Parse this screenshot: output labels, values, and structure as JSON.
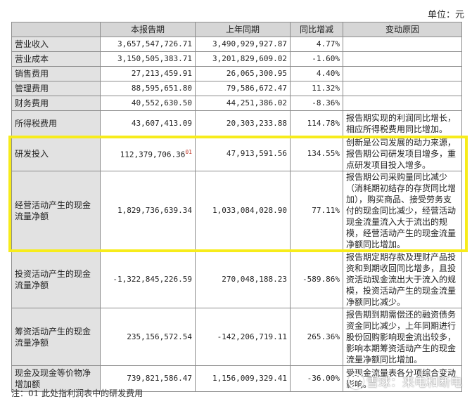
{
  "unit_label": "单位：元",
  "headers": [
    "",
    "本报告期",
    "上年同期",
    "同比增减",
    "变动原因"
  ],
  "rows": [
    {
      "name": "营业收入",
      "current": "3,657,547,726.71",
      "previous": "3,490,929,927.87",
      "change": "4.77%",
      "reason": ""
    },
    {
      "name": "营业成本",
      "current": "3,150,505,383.71",
      "previous": "3,201,829,609.02",
      "change": "-1.60%",
      "reason": ""
    },
    {
      "name": "销售费用",
      "current": "27,213,459.91",
      "previous": "26,065,300.95",
      "change": "4.40%",
      "reason": ""
    },
    {
      "name": "管理费用",
      "current": "88,595,651.80",
      "previous": "79,586,672.47",
      "change": "11.32%",
      "reason": ""
    },
    {
      "name": "财务费用",
      "current": "40,552,630.50",
      "previous": "44,251,386.02",
      "change": "-8.36%",
      "reason": ""
    },
    {
      "name": "所得税费用",
      "current": "43,607,413.09",
      "previous": "20,303,233.88",
      "change": "114.78%",
      "reason": "报告期实现的利润同比增长，相应所得税费用同比增加。"
    },
    {
      "name": "研发投入",
      "current": "112,379,706.36",
      "current_note": "01",
      "previous": "47,913,591.56",
      "change": "134.55%",
      "reason": "创新是公司发展的动力来源，报告期公司研发项目增多，重点研发项目投入增多。"
    },
    {
      "name": "经营活动产生的现金流量净额",
      "current": "1,829,736,639.34",
      "previous": "1,033,084,028.90",
      "change": "77.11%",
      "reason": "报告期公司采购量同比减少（消耗期初结存的存货同比增加），购买商品、接受劳务支付的现金同比减少，经营活动现金流量流入大于流出的规模，经营活动产生的现金流量净额同比增加。"
    },
    {
      "name": "投资活动产生的现金流量净额",
      "current": "-1,322,845,226.59",
      "previous": "270,048,188.23",
      "change": "-589.86%",
      "reason": "报告期定期存款及理财产品投资和到期收回同比增多，且投资活动现金流出大于流入的规模，投资活动产生的现金流量净额同比减少。"
    },
    {
      "name": "筹资活动产生的现金流量净额",
      "current": "235,156,572.54",
      "previous": "-142,206,719.11",
      "change": "265.36%",
      "reason": "报告期到期需偿还的融资债务资金同比减少，上年同期进行股份回购影响现金流出较多，影响本期筹资活动产生的现金流量净额同比增加。"
    },
    {
      "name": "现金及现金等价物净增加额",
      "current": "739,821,586.47",
      "previous": "1,156,009,329.41",
      "change": "-36.00%",
      "reason": "受现金流量表各分项综合变动影响。"
    }
  ],
  "footnote": "注：01 此处指利润表中的研发费用",
  "watermark": "雪球：来电和断电"
}
